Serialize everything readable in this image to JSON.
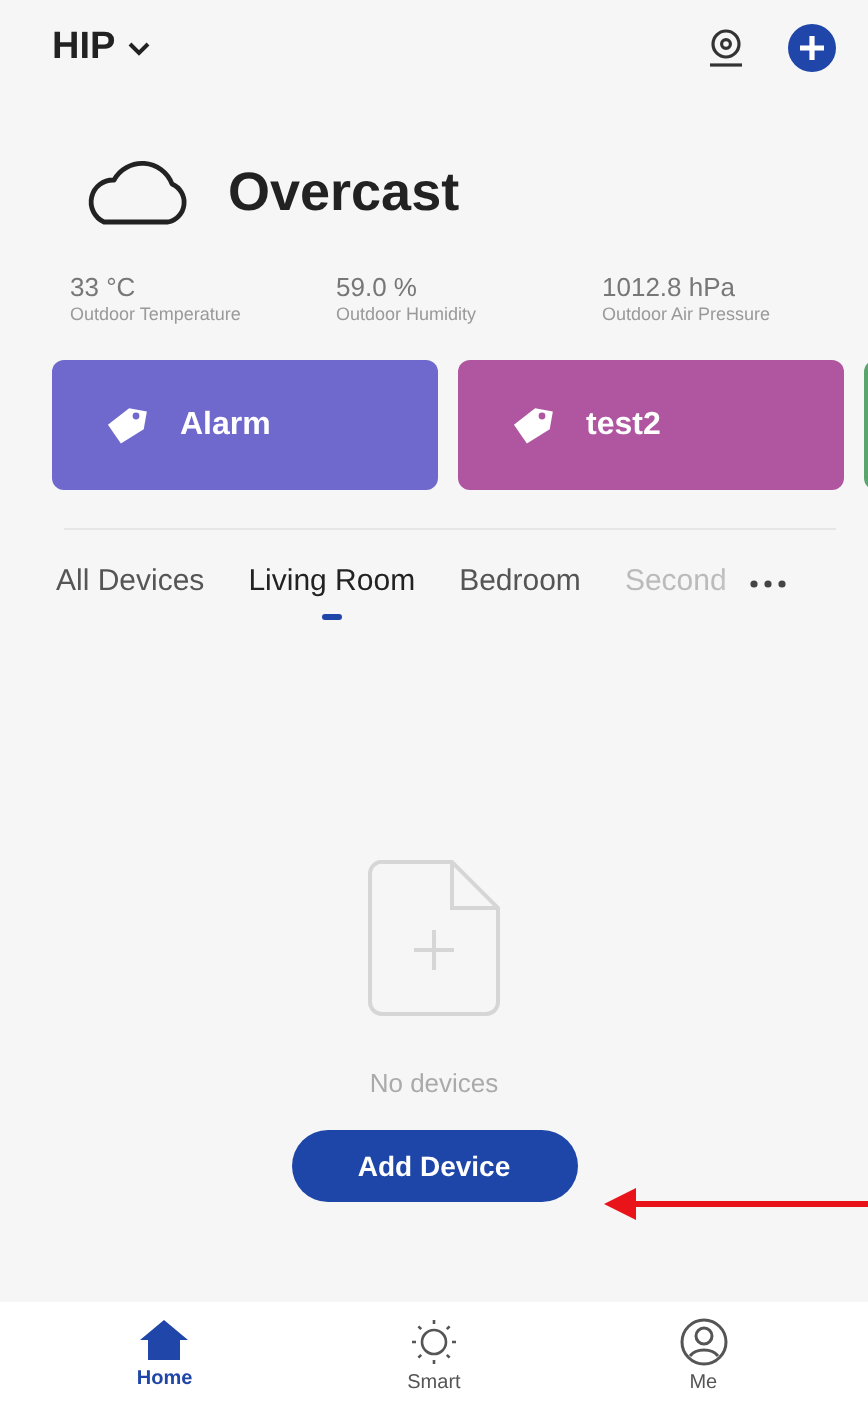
{
  "header": {
    "home_name": "HIP"
  },
  "weather": {
    "condition": "Overcast",
    "stats": [
      {
        "value": "33 °C",
        "label": "Outdoor Temperature"
      },
      {
        "value": "59.0 %",
        "label": "Outdoor Humidity"
      },
      {
        "value": "1012.8 hPa",
        "label": "Outdoor Air Pressure"
      }
    ]
  },
  "scenes": [
    {
      "name": "Alarm",
      "color": "#6f69cd"
    },
    {
      "name": "test2",
      "color": "#b056a0"
    },
    {
      "color": "#5aa56e"
    }
  ],
  "tabs": [
    {
      "label": "All Devices",
      "selected": false
    },
    {
      "label": "Living Room",
      "selected": true
    },
    {
      "label": "Bedroom",
      "selected": false
    },
    {
      "label": "Second",
      "selected": false
    }
  ],
  "empty_state": {
    "message": "No devices",
    "button": "Add Device"
  },
  "bottom_nav": [
    {
      "label": "Home",
      "kind": "home",
      "selected": true
    },
    {
      "label": "Smart",
      "kind": "smart",
      "selected": false
    },
    {
      "label": "Me",
      "kind": "me",
      "selected": false
    }
  ]
}
